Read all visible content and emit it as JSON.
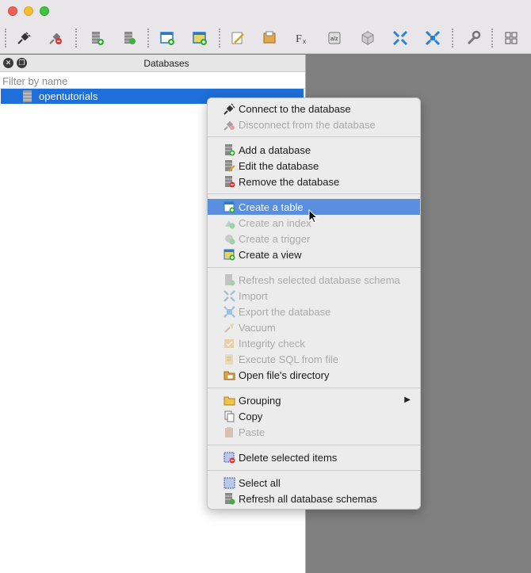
{
  "panel": {
    "title": "Databases",
    "filter_placeholder": "Filter by name",
    "databases": [
      "opentutorials"
    ]
  },
  "context_menu": {
    "items": [
      {
        "label": "Connect to the database",
        "enabled": true
      },
      {
        "label": "Disconnect from the database",
        "enabled": false
      },
      {
        "label": "Add a database",
        "enabled": true
      },
      {
        "label": "Edit the database",
        "enabled": true
      },
      {
        "label": "Remove the database",
        "enabled": true
      },
      {
        "label": "Create a table",
        "enabled": true,
        "highlighted": true
      },
      {
        "label": "Create an index",
        "enabled": false
      },
      {
        "label": "Create a trigger",
        "enabled": false
      },
      {
        "label": "Create a view",
        "enabled": true
      },
      {
        "label": "Refresh selected database schema",
        "enabled": false
      },
      {
        "label": "Import",
        "enabled": false
      },
      {
        "label": "Export the database",
        "enabled": false
      },
      {
        "label": "Vacuum",
        "enabled": false
      },
      {
        "label": "Integrity check",
        "enabled": false
      },
      {
        "label": "Execute SQL from file",
        "enabled": false
      },
      {
        "label": "Open file's directory",
        "enabled": true
      },
      {
        "label": "Grouping",
        "enabled": true,
        "submenu": true
      },
      {
        "label": "Copy",
        "enabled": true
      },
      {
        "label": "Paste",
        "enabled": false
      },
      {
        "label": "Delete selected items",
        "enabled": true
      },
      {
        "label": "Select all",
        "enabled": true
      },
      {
        "label": "Refresh all database schemas",
        "enabled": true
      }
    ]
  },
  "colors": {
    "selection": "#1e6fd9",
    "menu_highlight": "#5a8fe0",
    "disabled_text": "#aaaaaa"
  }
}
